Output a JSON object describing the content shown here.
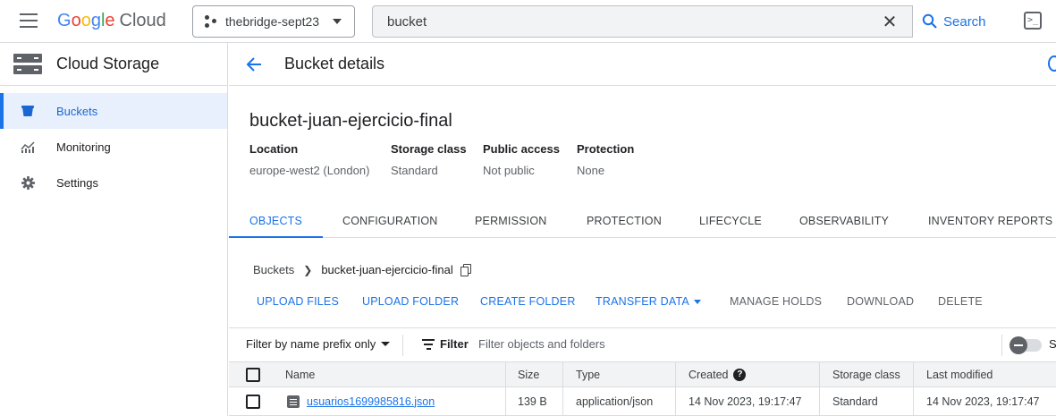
{
  "topbar": {
    "logo": {
      "google": "Google",
      "cloud": "Cloud"
    },
    "project_name": "thebridge-sept23",
    "search": {
      "value": "bucket",
      "button_label": "Search"
    }
  },
  "sidebar": {
    "title": "Cloud Storage",
    "items": [
      {
        "label": "Buckets",
        "icon": "bucket-icon",
        "active": true
      },
      {
        "label": "Monitoring",
        "icon": "monitoring-icon",
        "active": false
      },
      {
        "label": "Settings",
        "icon": "gear-icon",
        "active": false
      }
    ]
  },
  "header": {
    "title": "Bucket details"
  },
  "bucket": {
    "name": "bucket-juan-ejercicio-final",
    "meta": [
      {
        "key": "Location",
        "value": "europe-west2 (London)"
      },
      {
        "key": "Storage class",
        "value": "Standard"
      },
      {
        "key": "Public access",
        "value": "Not public"
      },
      {
        "key": "Protection",
        "value": "None"
      }
    ]
  },
  "tabs": [
    "OBJECTS",
    "CONFIGURATION",
    "PERMISSION",
    "PROTECTION",
    "LIFECYCLE",
    "OBSERVABILITY",
    "INVENTORY REPORTS"
  ],
  "breadcrumb": {
    "root": "Buckets",
    "current": "bucket-juan-ejercicio-final"
  },
  "actions": {
    "upload_files": "UPLOAD FILES",
    "upload_folder": "UPLOAD FOLDER",
    "create_folder": "CREATE FOLDER",
    "transfer_data": "TRANSFER DATA",
    "manage_holds": "MANAGE HOLDS",
    "download": "DOWNLOAD",
    "delete": "DELETE"
  },
  "filter": {
    "prefix_label": "Filter by name prefix only",
    "filter_label": "Filter",
    "placeholder": "Filter objects and folders",
    "toggle_label": "S"
  },
  "table": {
    "columns": [
      "Name",
      "Size",
      "Type",
      "Created",
      "Storage class",
      "Last modified"
    ],
    "rows": [
      {
        "name": "usuarios1699985816.json",
        "size": "139 B",
        "type": "application/json",
        "created": "14 Nov 2023, 19:17:47",
        "storage_class": "Standard",
        "last_modified": "14 Nov 2023, 19:17:47"
      }
    ]
  },
  "colors": {
    "accent": "#1a73e8",
    "active_bg": "#e8f0fe"
  }
}
